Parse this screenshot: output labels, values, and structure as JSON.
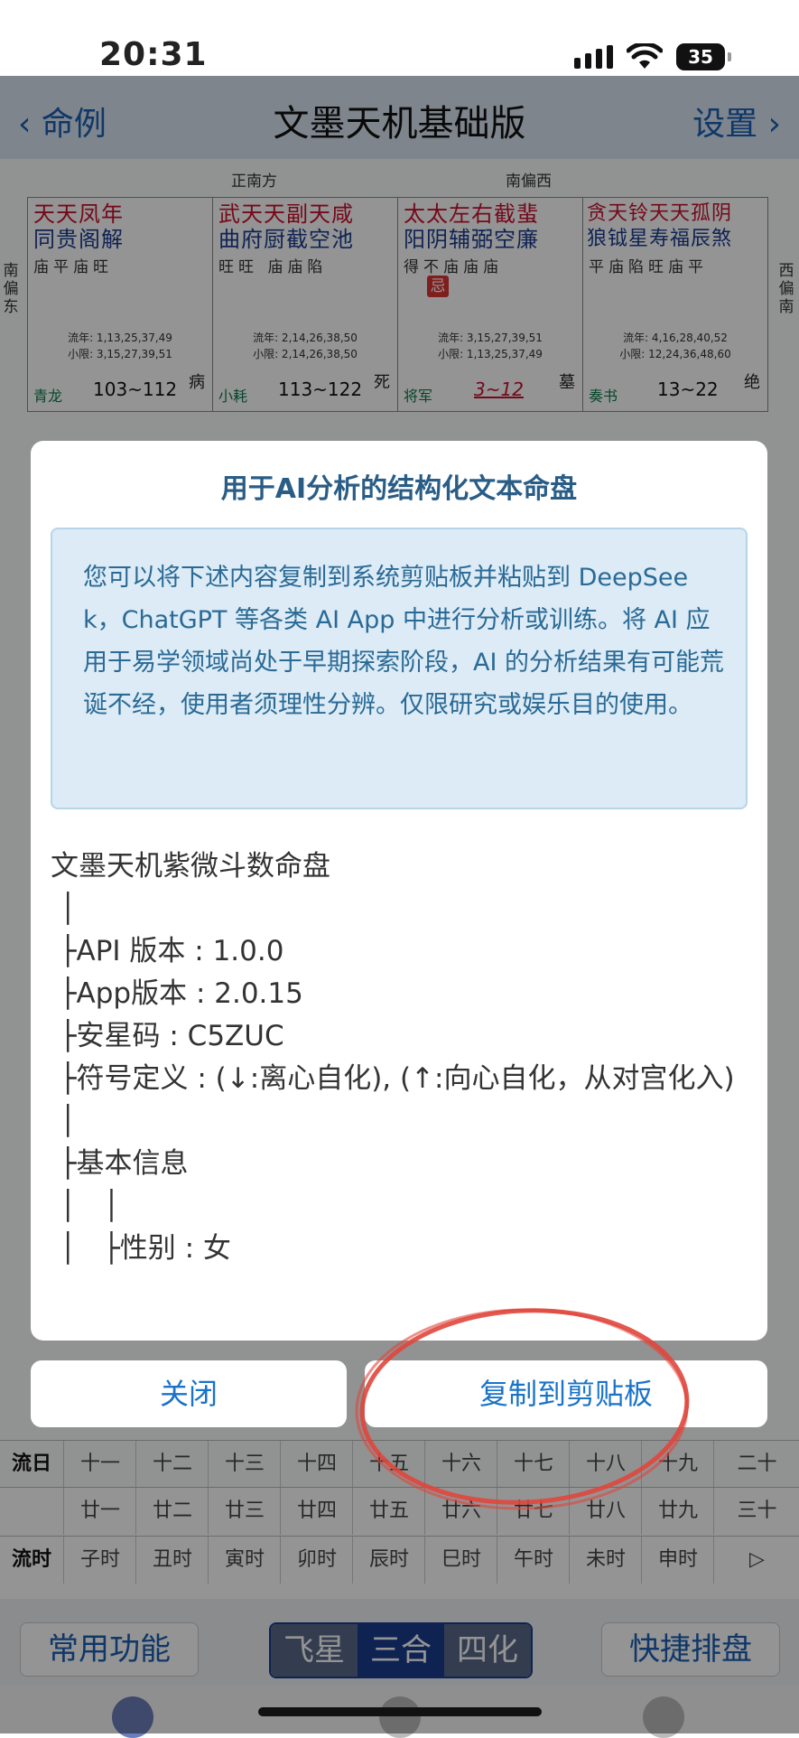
{
  "status_bar": {
    "time": "20:31",
    "battery": "35"
  },
  "nav": {
    "back_label": "命例",
    "title": "文墨天机基础版",
    "settings_label": "设置"
  },
  "chart": {
    "dir_south": "正南方",
    "dir_southwest": "南偏西",
    "left_side_dir": "南偏东",
    "right_side_dir": "西偏南",
    "palaces": [
      {
        "stars_row1": "天天凤年",
        "stars_row2": "同贵阁解",
        "brightness": "庙平庙旺",
        "liunian": "流年: 1,13,25,37,49",
        "xiaoxian": "小限: 3,15,27,39,51",
        "lower_left": "青龙",
        "age": "103~112",
        "corner": "病"
      },
      {
        "stars_row1": "武天天副天咸",
        "stars_row2": "曲府厨截空池",
        "brightness": "旺旺 庙庙陷",
        "liunian": "流年: 2,14,26,38,50",
        "xiaoxian": "小限: 2,14,26,38,50",
        "lower_left": "小耗",
        "age": "113~122",
        "corner": "死"
      },
      {
        "stars_row1": "太太左右截蜚",
        "stars_row2": "阳阴辅弼空廉",
        "brightness": "得不庙庙庙",
        "hua": "忌",
        "liunian": "流年: 3,15,27,39,51",
        "xiaoxian": "小限: 1,13,25,37,49",
        "lower_left": "将军",
        "age": "3~12",
        "corner": "墓"
      },
      {
        "stars_row1": "贪天铃天天孤阴",
        "stars_row2": "狼钺星寿福辰煞",
        "brightness": "平庙陷旺庙平",
        "liunian": "流年: 4,16,28,40,52",
        "xiaoxian": "小限: 12,24,36,48,60",
        "lower_left": "奏书",
        "age": "13~22",
        "corner": "绝"
      }
    ],
    "liuri_label": "流日",
    "liuri_row1": [
      "十一",
      "十二",
      "十三",
      "十四",
      "十五",
      "十六",
      "十七",
      "十八",
      "十九",
      "二十"
    ],
    "liuri_row2": [
      "廿一",
      "廿二",
      "廿三",
      "廿四",
      "廿五",
      "廿六",
      "廿七",
      "廿八",
      "廿九",
      "三十"
    ],
    "liushi_label": "流时",
    "liushi_row": [
      "子时",
      "丑时",
      "寅时",
      "卯时",
      "辰时",
      "巳时",
      "午时",
      "未时",
      "申时",
      "▷"
    ]
  },
  "bottom": {
    "common_label": "常用功能",
    "seg": [
      "飞星",
      "三合",
      "四化"
    ],
    "quick_label": "快捷排盘"
  },
  "dialog": {
    "title": "用于AI分析的结构化文本命盘",
    "notice": "您可以将下述内容复制到系统剪贴板并粘贴到 DeepSeek，ChatGPT 等各类 AI App 中进行分析或训练。将 AI 应用于易学领域尚处于早期探索阶段，AI 的分析结果有可能荒诞不经，使用者须理性分辨。仅限研究或娱乐目的使用。",
    "content": "文墨天机紫微斗数命盘\n │\n ├API 版本 : 1.0.0\n ├App版本 : 2.0.15\n ├安星码 : C5ZUC\n ├符号定义 : (↓:离心自化), (↑:向心自化，从对宫化入)\n │\n ├基本信息\n │   │\n │   ├性别 : 女",
    "close_label": "关闭",
    "copy_label": "复制到剪贴板"
  },
  "colors": {
    "accent": "#1a73c8",
    "dialog_title": "#2a5d86",
    "notice_bg": "#dcebf5",
    "annotation_red": "#e0463c"
  }
}
